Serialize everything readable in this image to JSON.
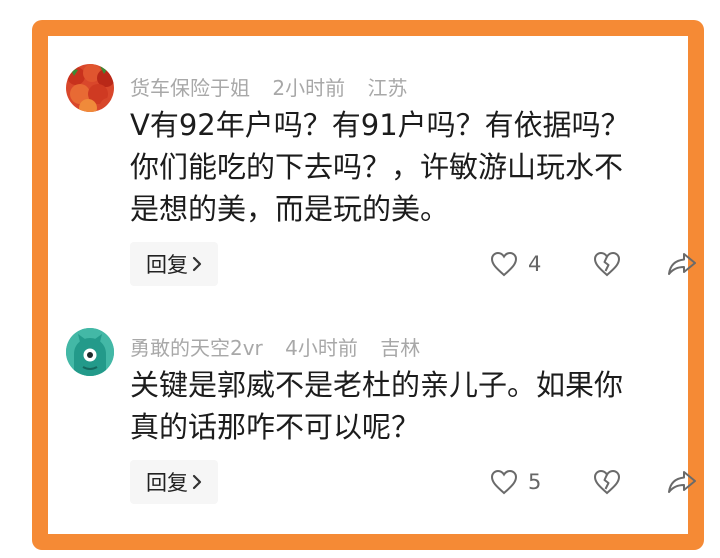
{
  "comments": [
    {
      "username": "货车保险于姐",
      "time": "2小时前",
      "location": "江苏",
      "body_lines": [
        "V有92年户吗？有91户吗？有依据吗？",
        "你们能吃的下去吗？，许敏游山玩水不",
        "是想的美，而是玩的美。"
      ],
      "reply_label": "回复",
      "like_count": "4"
    },
    {
      "username": "勇敢的天空2vr",
      "time": "4小时前",
      "location": "吉林",
      "body_lines": [
        "关键是郭威不是老杜的亲儿子。如果你",
        "真的话那咋不可以呢？"
      ],
      "reply_label": "回复",
      "like_count": "5"
    }
  ],
  "colors": {
    "frame": "#f58a35",
    "meta": "#a8a8a8",
    "text": "#1c1c1c",
    "icon": "#6a6a6a"
  },
  "icons": [
    "heart-icon",
    "broken-heart-icon",
    "share-icon",
    "chevron-right-icon"
  ]
}
